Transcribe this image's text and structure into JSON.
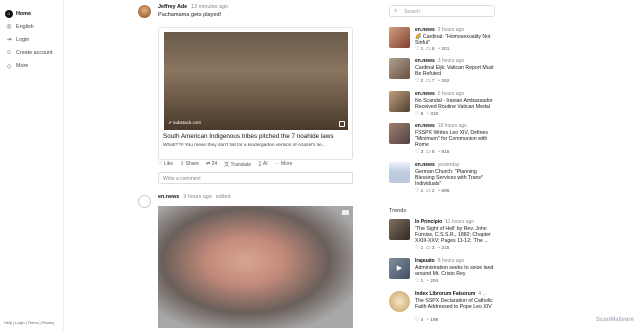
{
  "sidebar": {
    "items": [
      {
        "label": "Home",
        "icon": "home-icon",
        "glyph": "⌂",
        "active": true
      },
      {
        "label": "English",
        "icon": "globe-icon",
        "glyph": "◎",
        "active": false
      },
      {
        "label": "Login",
        "icon": "login-icon",
        "glyph": "⇥",
        "active": false
      },
      {
        "label": "Create account",
        "icon": "person-add-icon",
        "glyph": "☺",
        "active": false
      },
      {
        "label": "More",
        "icon": "more-icon",
        "glyph": "◇",
        "active": false
      }
    ],
    "footer": "Help | Login | Terms | Privacy"
  },
  "posts": [
    {
      "author": "Jeffrey Ade",
      "time": "13 minutes ago",
      "text": "Pachamama gets played!",
      "card": {
        "domain": "substack.com",
        "title": "South American Indigenous tribes pitched the 7 noahide laws",
        "desc": "What!??!! You mean they don't fall for a kindergarten version of Azazel's lie..."
      },
      "actions": {
        "like": "Like",
        "share": "Share",
        "reply_count": "24",
        "translate": "Translate",
        "ai": "AI",
        "more": "More"
      },
      "comment_placeholder": "Write a comment"
    },
    {
      "author": "en.news",
      "time": "3 hours ago",
      "edited": "edited"
    }
  ],
  "search": {
    "placeholder": "Search"
  },
  "news": [
    {
      "source": "en.news",
      "time": "2 hours ago",
      "title": "🌈 Cardinal: \"Homosexuality Not Sinful\"",
      "likes": "1",
      "comments": "6",
      "views": "201"
    },
    {
      "source": "en.news",
      "time": "3 hours ago",
      "title": "Cardinal Eijk: Vatican Report Must Be Refuted",
      "likes": "2",
      "comments": "7",
      "views": "262"
    },
    {
      "source": "en.news",
      "time": "5 hours ago",
      "title": "No Scandal - Iranian Ambassador Received Routine Vatican Medal",
      "likes": "6",
      "comments": "",
      "views": "319"
    },
    {
      "source": "en.news",
      "time": "18 hours ago",
      "title": "FSSPX Writes Leo XIV, Defines \"Minimum\" for Communion with Rome",
      "likes": "3",
      "comments": "8",
      "views": "915"
    },
    {
      "source": "en.news",
      "time": "yesterday",
      "title": "German Church: \"Planning Blessing Services with Trans* Individuals\"",
      "likes": "1",
      "comments": "2",
      "views": "696"
    }
  ],
  "trends": {
    "label": "Trends",
    "items": [
      {
        "source": "In Principio",
        "time": "11 hours ago",
        "title": "'The Sight of Hell' by Rev. John Furniss, C.S.S.R., 1882; Chapter XXIII-XXV; Pages 11-12; 'The ...",
        "likes": "1",
        "comments": "3",
        "views": "215"
      },
      {
        "source": "Irapuato",
        "time": "8 hours ago",
        "title": "Administration seeks to seize land around Mt. Cristo Rey",
        "likes": "1",
        "comments": "",
        "views": "204"
      },
      {
        "source": "Index Librorum Falsorum",
        "time": "4 ...",
        "title": "The SSPX Declaration of Catholic Faith Addressed to Pope Leo XIV",
        "likes": "4",
        "comments": "",
        "views": "198"
      }
    ]
  },
  "watermark": "ScanMalware"
}
